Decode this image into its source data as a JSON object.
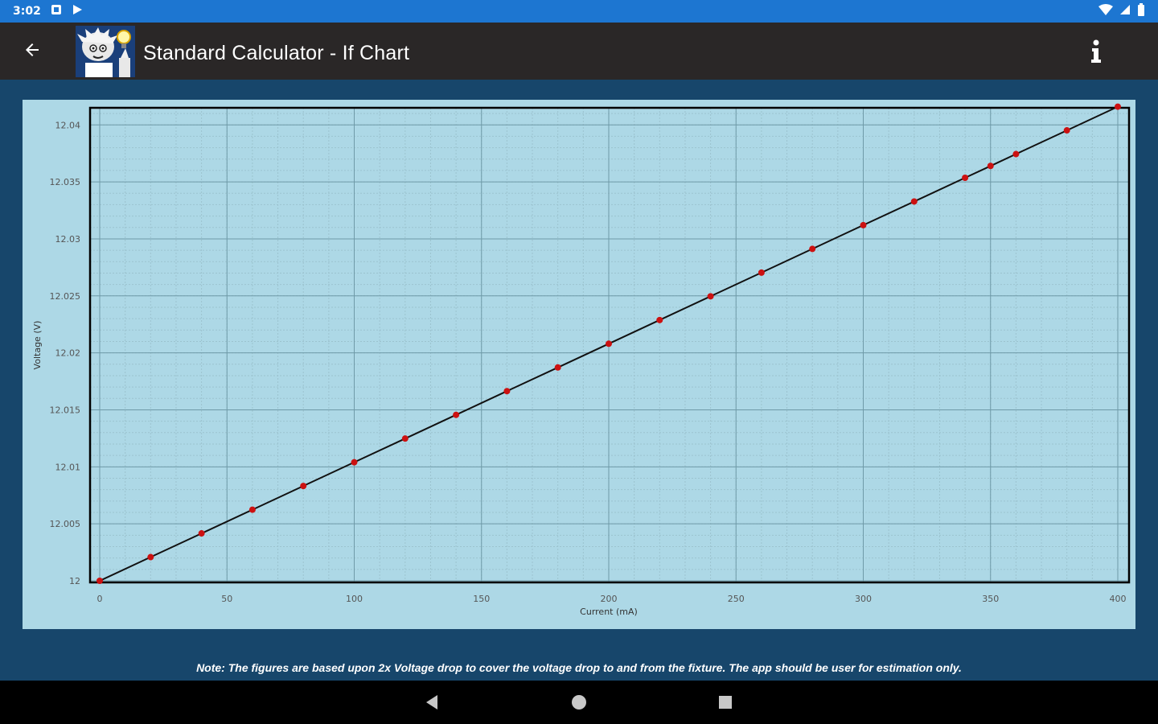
{
  "status_bar": {
    "time": "3:02",
    "left_icons": [
      "notification-square-icon",
      "play-store-icon"
    ],
    "right_icons": [
      "wifi-icon",
      "signal-icon",
      "battery-icon"
    ],
    "bg_color": "#1d76d1"
  },
  "app_bar": {
    "title": "Standard Calculator - If Chart",
    "back_icon": "arrow-left-icon",
    "info_icon": "info-icon",
    "bg_color": "#2a2727"
  },
  "note": "Note: The figures are based upon 2x Voltage drop to cover the voltage drop to and from the fixture. The app should be user for estimation only.",
  "colors": {
    "background": "#17466b",
    "chart_bg": "#add8e6",
    "line": "#111111",
    "marker": "#cc1111"
  },
  "chart_data": {
    "type": "line",
    "xlabel": "Current (mA)",
    "ylabel": "Voltage (V)",
    "xlim": [
      0,
      400
    ],
    "ylim": [
      12,
      12.0415
    ],
    "x_ticks": [
      0,
      50,
      100,
      150,
      200,
      250,
      300,
      350,
      400
    ],
    "x_tick_labels": [
      "0",
      "50",
      "100",
      "150",
      "200",
      "250",
      "300",
      "350",
      "400"
    ],
    "y_ticks": [
      12,
      12.005,
      12.01,
      12.015,
      12.02,
      12.025,
      12.03,
      12.035,
      12.04
    ],
    "y_tick_labels": [
      "12",
      "12.005",
      "12.01",
      "12.015",
      "12.02",
      "12.025",
      "12.03",
      "12.035",
      "12.04"
    ],
    "grid": true,
    "series": [
      {
        "x": [
          0,
          20,
          40,
          60,
          80,
          100,
          120,
          140,
          160,
          180,
          200,
          220,
          240,
          260,
          280,
          300,
          320,
          340,
          350,
          360,
          380,
          400
        ],
        "y": [
          12.0,
          12.00208,
          12.00416,
          12.00624,
          12.00832,
          12.0104,
          12.01248,
          12.01456,
          12.01664,
          12.01872,
          12.0208,
          12.02288,
          12.02496,
          12.02704,
          12.02912,
          12.0312,
          12.03328,
          12.03536,
          12.0364,
          12.03744,
          12.03952,
          12.0416
        ]
      }
    ]
  }
}
